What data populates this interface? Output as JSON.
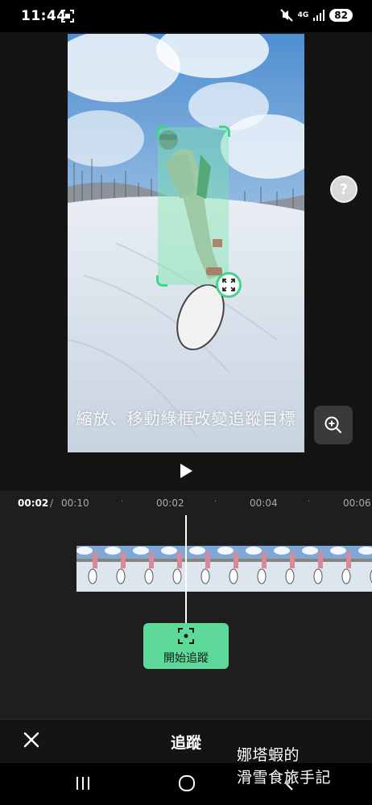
{
  "status_bar": {
    "time": "11:44",
    "network": "4G",
    "battery": "82",
    "icons": [
      "screen-capture-icon",
      "mute-icon",
      "signal-icon"
    ]
  },
  "preview": {
    "hint": "縮放、移動綠框改變追蹤目標"
  },
  "timeline": {
    "current_time": "00:02",
    "separator": "/",
    "total_time": "00:10",
    "ticks": [
      "00:02",
      "00:04",
      "00:06"
    ],
    "start_tracking_label": "開始追蹤"
  },
  "bottom_bar": {
    "title": "追蹤"
  },
  "watermark": {
    "line1": "娜塔蝦的",
    "line2": "滑雪食旅手記"
  },
  "colors": {
    "accent": "#5fd99a",
    "tracker_border": "#3fd68a",
    "timeline_bg": "#1e1e1e"
  }
}
